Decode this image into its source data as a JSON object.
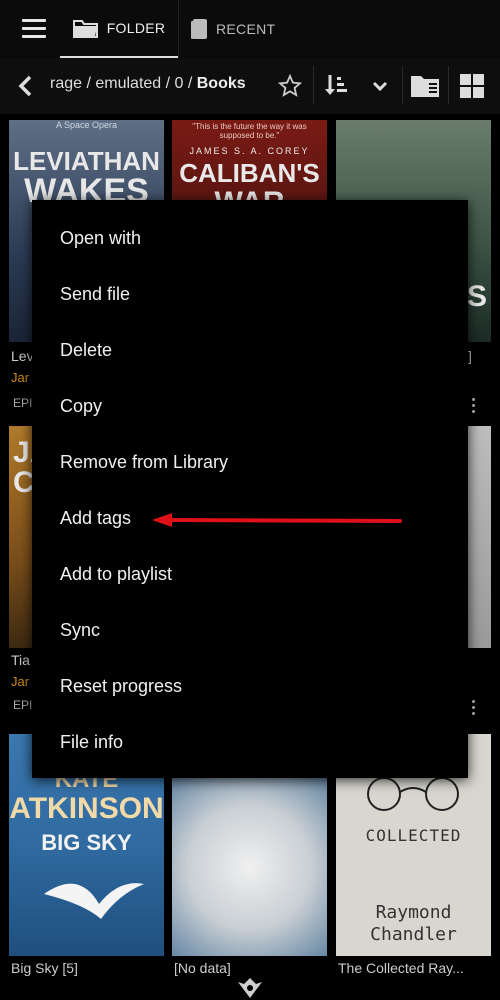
{
  "tabs": {
    "folder": "FOLDER",
    "recent": "RECENT"
  },
  "path": {
    "prefix": "rage / emulated / 0 / ",
    "current": "Books"
  },
  "books": [
    {
      "cover_line1": "LEVIATHAN",
      "cover_line2": "WAKES",
      "cover_top": "A Space Opera",
      "filename": "Lev",
      "author": "Jar",
      "format": "EPI"
    },
    {
      "cover_line1": "CALIBAN'S",
      "cover_line2": "WAR",
      "cover_top": "\"This is the future the way it was supposed to be.\"",
      "cover_author": "JAMES S. A. COREY",
      "filename": "",
      "author": "",
      "format": ""
    },
    {
      "cover_line1": "",
      "cover_line2": "ES",
      "filename": "]",
      "author": "",
      "format": ""
    },
    {
      "cover_line1": "JA",
      "cover_line2": "C",
      "filename": "Tia",
      "author": "Jar",
      "format": "EPI"
    },
    {
      "filename": "",
      "author": "",
      "format": ""
    },
    {
      "filename": "...",
      "author": "",
      "format": ""
    },
    {
      "cover_line1": "KATE",
      "cover_line2": "ATKINSON",
      "cover_sub": "BIG SKY",
      "filename": "Big Sky [5]"
    },
    {
      "filename": "[No data]"
    },
    {
      "cover_line1": "COLLECTED",
      "cover_line2": "Raymond",
      "cover_sub": "Chandler",
      "filename": "The Collected Ray..."
    }
  ],
  "menu": {
    "items": [
      "Open with",
      "Send file",
      "Delete",
      "Copy",
      "Remove from Library",
      "Add tags",
      "Add to playlist",
      "Sync",
      "Reset progress",
      "File info"
    ]
  },
  "colors": {
    "arrow": "#e0101a",
    "author": "#d18b1a"
  }
}
